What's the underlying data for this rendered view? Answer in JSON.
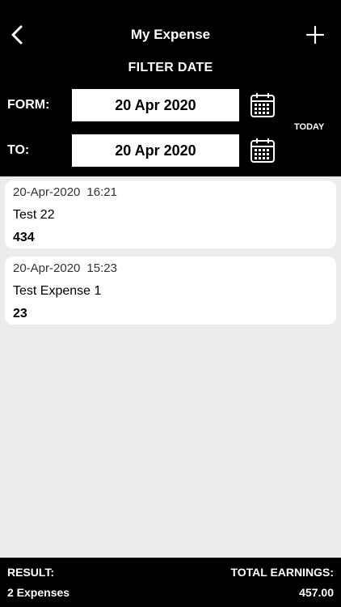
{
  "nav": {
    "title": "My Expense",
    "back_icon": "chevron-left-icon",
    "add_icon": "plus-icon"
  },
  "filter": {
    "title": "FILTER DATE",
    "from_label": "FORM:",
    "from_date": "20 Apr 2020",
    "to_label": "TO:",
    "to_date": "20 Apr 2020",
    "today_label": "TODAY",
    "calendar_icon": "calendar-icon"
  },
  "expenses": [
    {
      "date": "20-Apr-2020",
      "time": "16:21",
      "name": "Test 22",
      "amount": "434"
    },
    {
      "date": "20-Apr-2020",
      "time": "15:23",
      "name": "Test Expense 1",
      "amount": "23"
    }
  ],
  "footer": {
    "result_label": "RESULT:",
    "count": "2 Expenses",
    "total_label": "TOTAL EARNINGS:",
    "total": "457.00"
  },
  "colors": {
    "header_bg": "#000000",
    "list_bg": "#ececec",
    "card_bg": "#ffffff"
  }
}
